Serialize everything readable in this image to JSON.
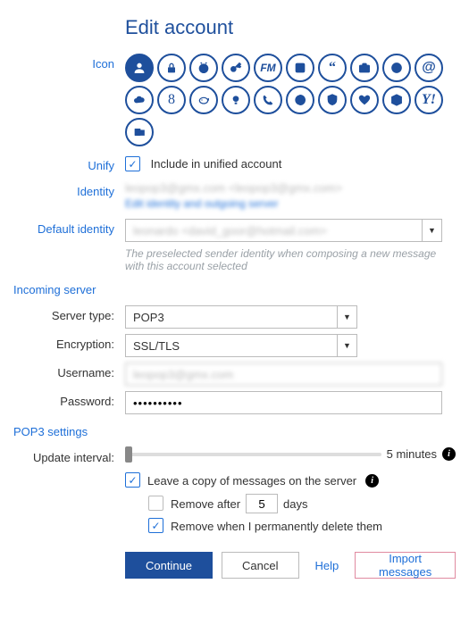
{
  "title": "Edit account",
  "labels": {
    "icon": "Icon",
    "unify": "Unify",
    "identity": "Identity",
    "default_identity": "Default identity",
    "server_type": "Server type:",
    "encryption": "Encryption:",
    "username": "Username:",
    "password": "Password:",
    "update_interval": "Update interval:"
  },
  "unify": {
    "checked": true,
    "label": "Include in unified account"
  },
  "identity": {
    "value_obscured": "leopop3@gmx.com <leopop3@gmx.com>",
    "edit_link": "Edit identity and outgoing server"
  },
  "default_identity": {
    "value_obscured": "leonardo <david_goor@hotmail.com>",
    "hint": "The preselected sender identity when composing a new message with this account selected"
  },
  "sections": {
    "incoming": "Incoming server",
    "pop3": "POP3 settings"
  },
  "server": {
    "type": "POP3",
    "encryption": "SSL/TLS",
    "username_obscured": "leopop3@gmx.com",
    "password_mask": "••••••••••"
  },
  "update": {
    "slider_label": "5 minutes"
  },
  "leave_copy": {
    "checked": true,
    "label": "Leave a copy of messages on the server",
    "remove_after_label_pre": "Remove after",
    "remove_after_value": "5",
    "remove_after_label_post": "days",
    "remove_after_checked": false,
    "remove_delete_checked": true,
    "remove_delete_label": "Remove when I permanently delete them"
  },
  "buttons": {
    "continue": "Continue",
    "cancel": "Cancel",
    "help": "Help",
    "import": "Import messages"
  },
  "icons": [
    "person-icon",
    "lock-icon",
    "clock-icon",
    "key-icon",
    "fm-icon",
    "box-icon",
    "quote-icon",
    "briefcase-icon",
    "globe-icon",
    "at-icon",
    "cloud-icon",
    "eight-icon",
    "piggy-icon",
    "bulb-icon",
    "phone-icon",
    "half-circle-icon",
    "shield-icon",
    "heart-icon",
    "cube-icon",
    "y-icon",
    "outlook-icon"
  ]
}
